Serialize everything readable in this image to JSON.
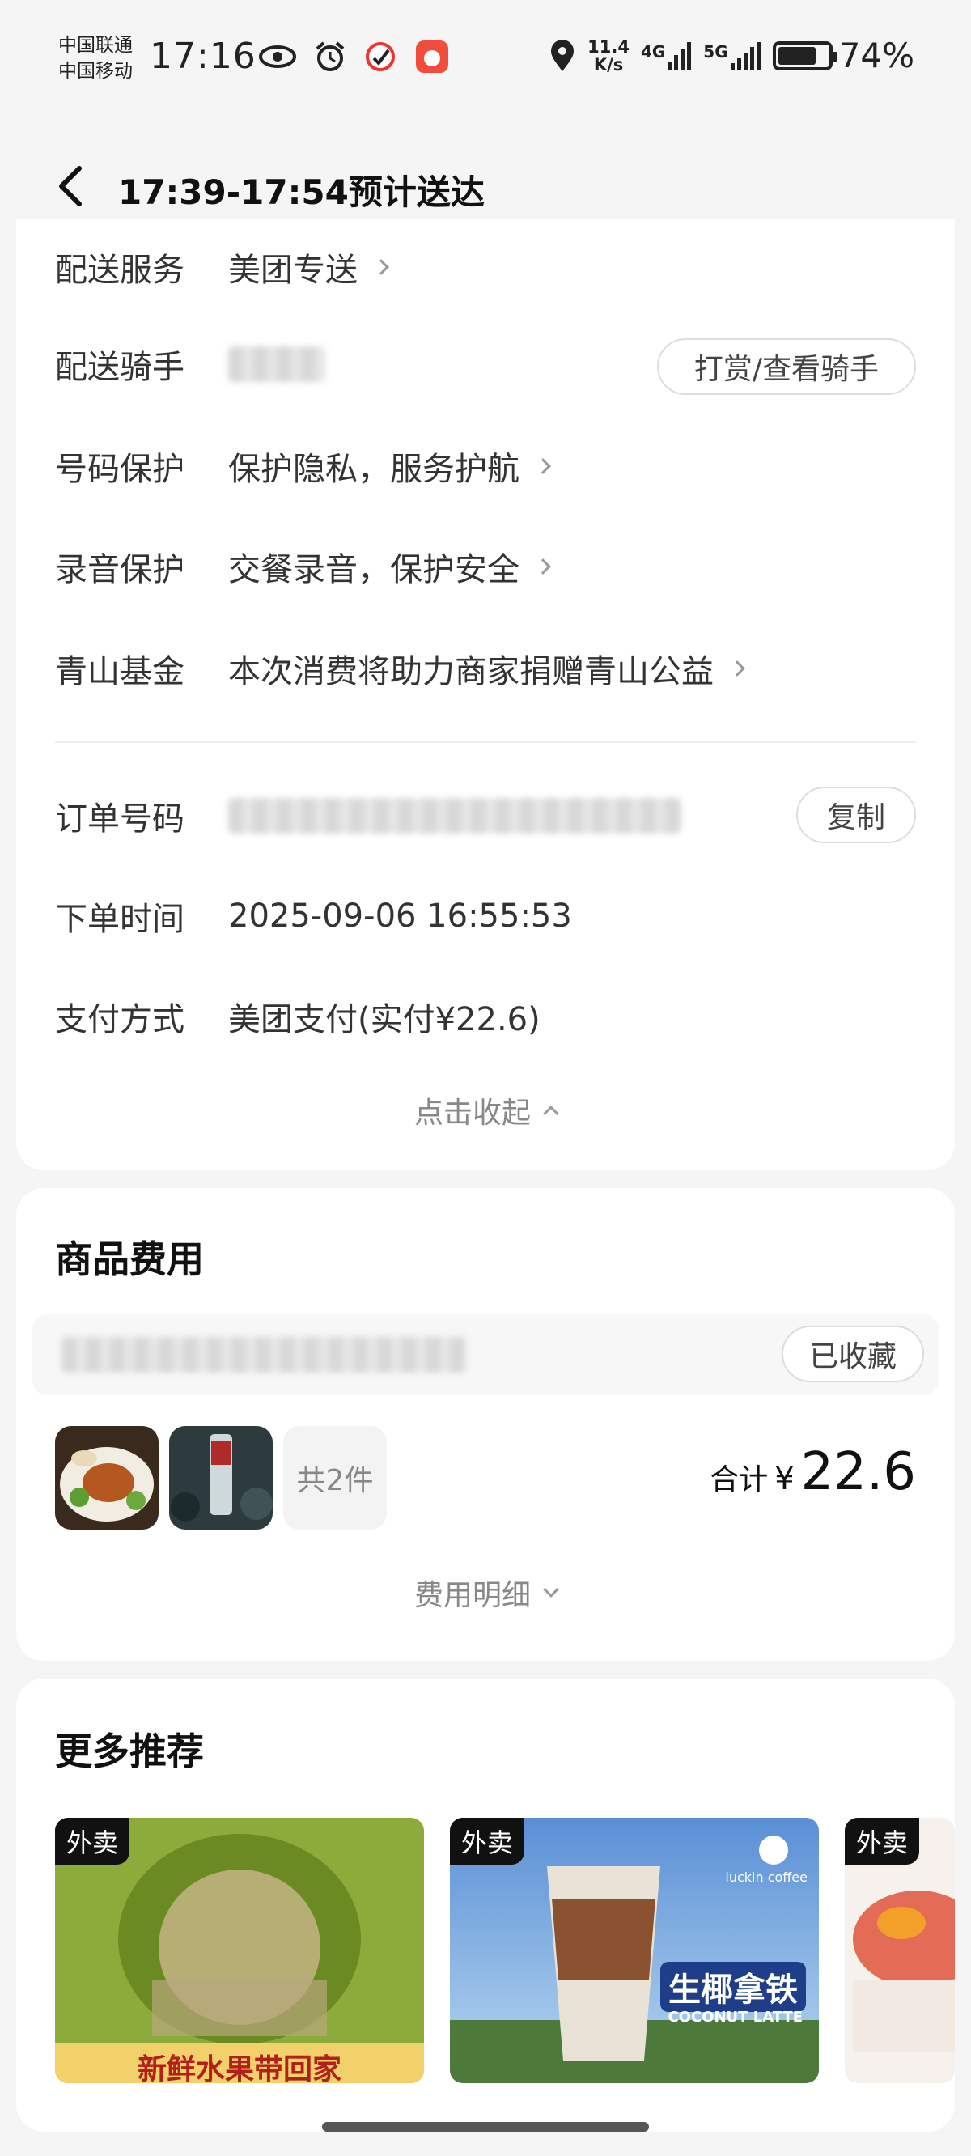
{
  "status_bar": {
    "carrier_1": "中国联通",
    "carrier_2": "中国移动",
    "time": "17:16",
    "net_speed_value": "11.4",
    "net_speed_unit": "K/s",
    "network_1": "4G",
    "network_2": "5G",
    "battery": "74%"
  },
  "header": {
    "title": "17:39-17:54预计送达"
  },
  "details": {
    "delivery_service_label": "配送服务",
    "delivery_service_value": "美团专送",
    "rider_label": "配送骑手",
    "rider_button": "打赏/查看骑手",
    "number_protect_label": "号码保护",
    "number_protect_value": "保护隐私，服务护航",
    "record_protect_label": "录音保护",
    "record_protect_value": "交餐录音，保护安全",
    "fund_label": "青山基金",
    "fund_value": "本次消费将助力商家捐赠青山公益",
    "order_no_label": "订单号码",
    "copy_button": "复制",
    "order_time_label": "下单时间",
    "order_time_value": "2025-09-06 16:55:53",
    "payment_label": "支付方式",
    "payment_value": "美团支付(实付¥22.6)",
    "collapse": "点击收起"
  },
  "goods": {
    "title": "商品费用",
    "collected_button": "已收藏",
    "count": "共2件",
    "total_label": "合计",
    "currency": "¥",
    "total_amount": "22.6",
    "fee_detail": "费用明细"
  },
  "recommend": {
    "title": "更多推荐",
    "tag": "外卖",
    "card1_caption": "新鲜水果带回家",
    "card2_brand": "luckin coffee",
    "card2_product": "生椰拿铁",
    "card2_sub": "COCONUT LATTE"
  }
}
